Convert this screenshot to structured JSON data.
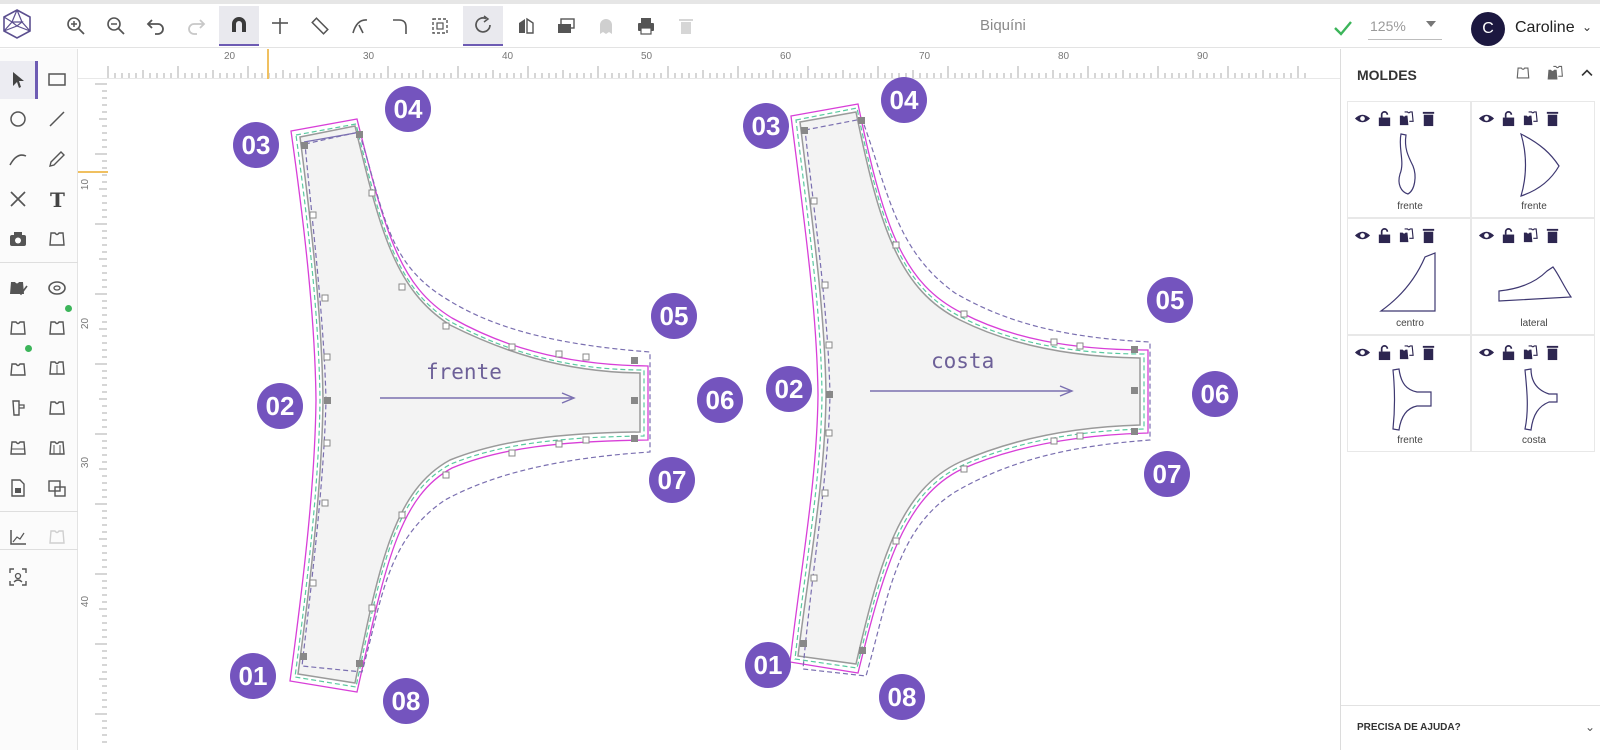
{
  "app": {
    "document_title": "Biquíni",
    "zoom": "125%",
    "user_initial": "C",
    "user_name": "Caroline",
    "accent_color": "#7454be",
    "save_status_color": "#3cb55a"
  },
  "toolbar": {
    "icons": [
      "zoom-in-icon",
      "zoom-out-icon",
      "undo-icon",
      "redo-icon",
      "magnet-icon",
      "crosshair-icon",
      "ruler-icon",
      "curve-icon",
      "corner-icon",
      "select-frame-icon",
      "rotate-icon",
      "mirror-icon",
      "stack-icon",
      "ghost-icon",
      "print-icon",
      "trash-icon"
    ]
  },
  "left_tools": [
    "select-icon",
    "rectangle-icon",
    "circle-icon",
    "line-icon",
    "curve-icon",
    "pencil-icon",
    "cross-icon",
    "text-icon",
    "camera-icon",
    "piece-icon",
    "check-piece-icon",
    "tape-icon",
    "shirt-icon",
    "shirt-badge-icon",
    "shirt-badge2-icon",
    "shirt-2-icon",
    "sleeve-icon",
    "shirt-3-icon",
    "shirt-4-icon",
    "shirt-5-icon",
    "doc-icon",
    "copy-piece-icon",
    "axis-icon",
    "layers-icon",
    "focus-icon"
  ],
  "ruler": {
    "top_labels": [
      "20",
      "30",
      "40",
      "50",
      "60",
      "70",
      "80",
      "90"
    ],
    "left_labels": [
      "10",
      "20",
      "30",
      "40"
    ]
  },
  "canvas": {
    "pieces": [
      {
        "label": "frente",
        "markers": [
          "03",
          "04",
          "05",
          "06",
          "07",
          "02",
          "01",
          "08"
        ]
      },
      {
        "label": "costa",
        "markers": [
          "03",
          "04",
          "05",
          "06",
          "07",
          "02",
          "01",
          "08"
        ]
      }
    ]
  },
  "panel": {
    "title": "MOLDES",
    "pieces": [
      {
        "name": "frente"
      },
      {
        "name": "frente"
      },
      {
        "name": "centro"
      },
      {
        "name": "lateral"
      },
      {
        "name": "frente"
      },
      {
        "name": "costa"
      }
    ],
    "help_label": "PRECISA DE AJUDA?"
  }
}
